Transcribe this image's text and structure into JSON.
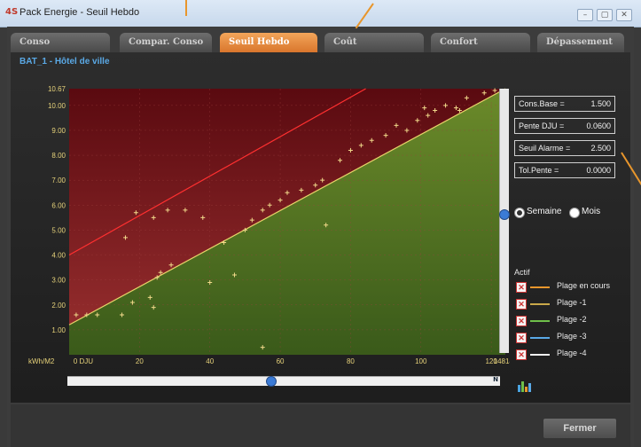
{
  "window": {
    "title": "Pack Energie - Seuil Hebdo",
    "app_icon": "4S"
  },
  "tabs": [
    "Conso",
    "Compar. Conso",
    "Seuil Hebdo",
    "Coût",
    "Confort",
    "Dépassement"
  ],
  "active_tab": "Seuil Hebdo",
  "subtitle": "BAT_1 - Hôtel de ville",
  "parameters": [
    {
      "label": "Cons.Base =",
      "value": "1.500"
    },
    {
      "label": "Pente DJU =",
      "value": "0.0600"
    },
    {
      "label": "Seuil Alarme =",
      "value": "2.500"
    },
    {
      "label": "Tol.Pente =",
      "value": "0.0000"
    }
  ],
  "period": {
    "options": [
      "Semaine",
      "Mois"
    ],
    "selected": "Semaine"
  },
  "legend": {
    "title": "Actif",
    "items": [
      {
        "label": "Plage en cours",
        "color": "#e8962c"
      },
      {
        "label": "Plage -1",
        "color": "#c9a84a"
      },
      {
        "label": "Plage -2",
        "color": "#6fbf4a"
      },
      {
        "label": "Plage -3",
        "color": "#5aa9e6"
      },
      {
        "label": "Plage -4",
        "color": "#f0f0f0"
      }
    ]
  },
  "scrollbar": {
    "nav_text": "N"
  },
  "buttons": {
    "close": "Fermer"
  },
  "chart_data": {
    "type": "scatter",
    "ylabel": "kWh/M2",
    "xlabel": "",
    "xlim": [
      0,
      148147
    ],
    "ylim": [
      0,
      10.67
    ],
    "x_ticks": [
      "0 DJU",
      "20",
      "40",
      "60",
      "80",
      "100",
      "120",
      "148147"
    ],
    "y_ticks": [
      "10.67",
      "10.00",
      "9.00",
      "8.00",
      "7.00",
      "6.00",
      "5.00",
      "4.00",
      "3.00",
      "2.00",
      "1.00"
    ],
    "threshold_line": {
      "color": "#ff3030",
      "y_at_x0": 4.0,
      "y_at_xmax": 10.67
    },
    "base_line": {
      "color": "#e8d36a",
      "y_at_x0": 1.2,
      "y_at_xmax": 10.67
    },
    "points": [
      [
        2,
        1.6
      ],
      [
        5,
        1.6
      ],
      [
        8,
        1.6
      ],
      [
        15,
        1.6
      ],
      [
        18,
        2.1
      ],
      [
        23,
        2.3
      ],
      [
        24,
        1.9
      ],
      [
        25,
        3.1
      ],
      [
        26,
        3.3
      ],
      [
        19,
        5.7
      ],
      [
        16,
        4.7
      ],
      [
        24,
        5.5
      ],
      [
        28,
        5.8
      ],
      [
        33,
        5.8
      ],
      [
        38,
        5.5
      ],
      [
        44,
        4.5
      ],
      [
        47,
        3.2
      ],
      [
        50,
        5.0
      ],
      [
        52,
        5.4
      ],
      [
        55,
        5.8
      ],
      [
        57,
        6.0
      ],
      [
        60,
        6.2
      ],
      [
        62,
        6.5
      ],
      [
        66,
        6.6
      ],
      [
        70,
        6.8
      ],
      [
        72,
        7.0
      ],
      [
        73,
        5.2
      ],
      [
        77,
        7.8
      ],
      [
        80,
        8.2
      ],
      [
        83,
        8.4
      ],
      [
        86,
        8.6
      ],
      [
        90,
        8.8
      ],
      [
        93,
        9.2
      ],
      [
        96,
        9.0
      ],
      [
        99,
        9.4
      ],
      [
        102,
        9.6
      ],
      [
        104,
        9.8
      ],
      [
        107,
        10.0
      ],
      [
        110,
        9.9
      ],
      [
        113,
        10.3
      ],
      [
        118,
        10.5
      ],
      [
        121,
        10.6
      ],
      [
        111,
        9.8
      ],
      [
        101,
        9.9
      ],
      [
        55,
        0.3
      ],
      [
        40,
        2.9
      ],
      [
        29,
        3.6
      ]
    ]
  }
}
